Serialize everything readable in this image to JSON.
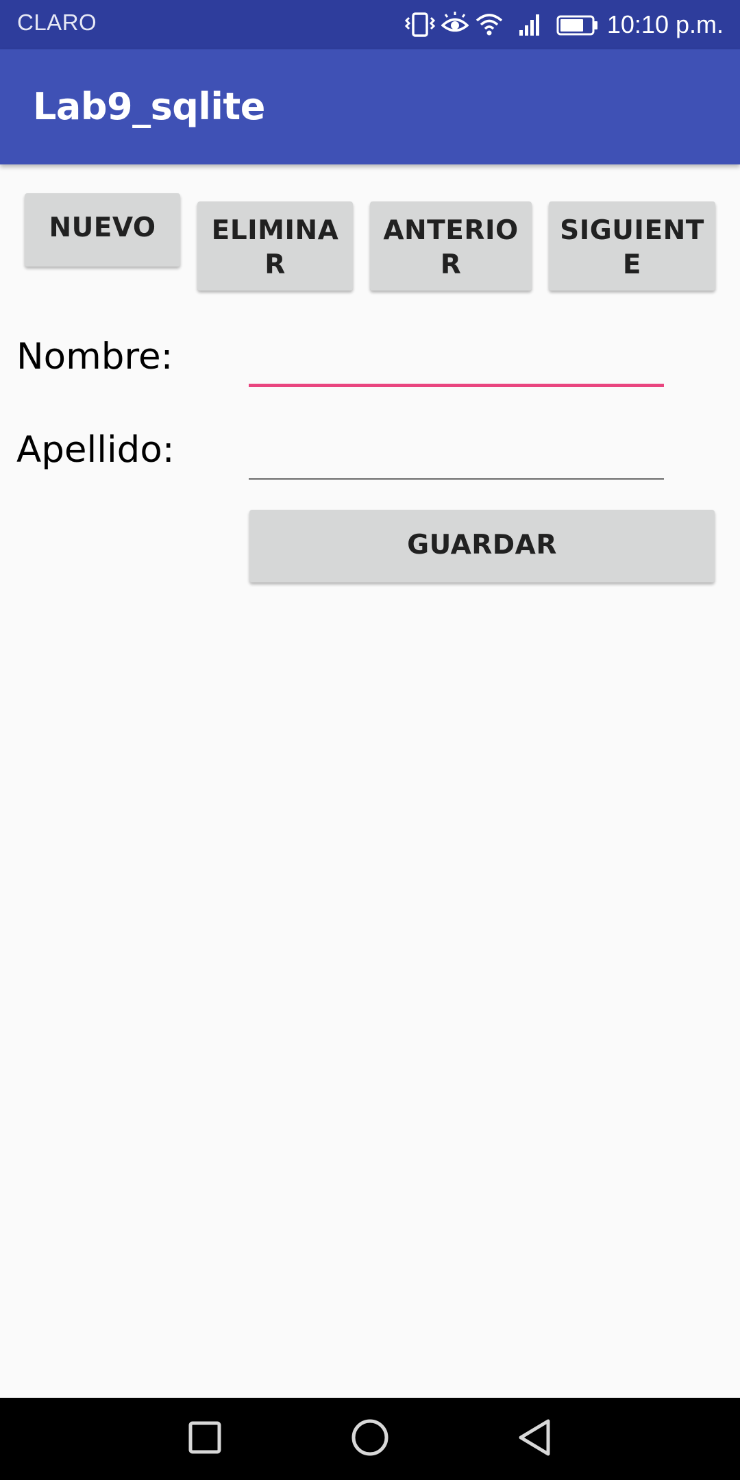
{
  "status_bar": {
    "carrier": "CLARO",
    "time": "10:10 p.m.",
    "icons": [
      "vibrate-icon",
      "eye-icon",
      "wifi-icon",
      "signal-icon",
      "battery-icon"
    ]
  },
  "app_bar": {
    "title": "Lab9_sqlite"
  },
  "toolbar": {
    "nuevo_label": "NUEVO",
    "eliminar_label": "ELIMINAR",
    "anterior_label": "ANTERIOR",
    "siguiente_label": "SIGUIENTE"
  },
  "form": {
    "nombre_label": "Nombre:",
    "nombre_value": "",
    "apellido_label": "Apellido:",
    "apellido_value": "",
    "guardar_label": "GUARDAR"
  },
  "nav_bar": {
    "icons": [
      "recents-icon",
      "home-icon",
      "back-icon"
    ]
  },
  "colors": {
    "status_bar": "#2e3d9c",
    "app_bar": "#3f51b5",
    "accent": "#e9457f",
    "button_bg": "#d6d7d7",
    "background": "#fafafa"
  }
}
